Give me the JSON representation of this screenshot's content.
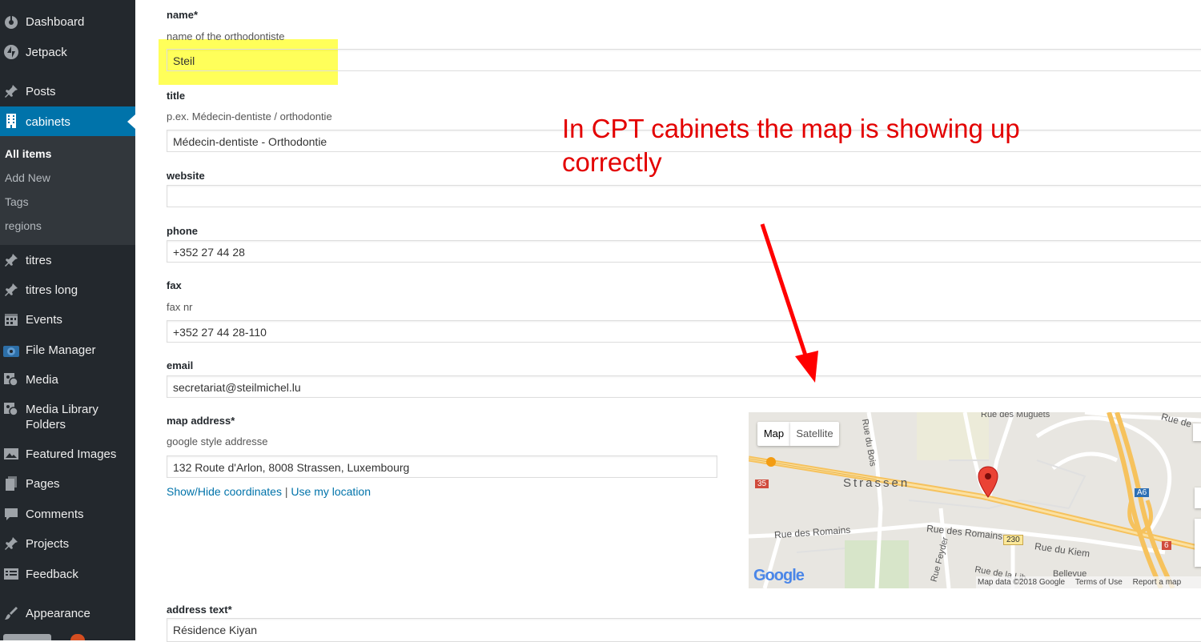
{
  "sidebar": {
    "items": [
      {
        "label": "Dashboard",
        "icon": "dashboard-icon"
      },
      {
        "label": "Jetpack",
        "icon": "jetpack-icon"
      },
      {
        "label": "Posts",
        "icon": "pin-icon"
      },
      {
        "label": "cabinets",
        "icon": "building-icon",
        "active": true
      },
      {
        "label": "titres",
        "icon": "pin-icon"
      },
      {
        "label": "titres long",
        "icon": "pin-icon"
      },
      {
        "label": "Events",
        "icon": "calendar-icon"
      },
      {
        "label": "File Manager",
        "icon": "file-manager-icon"
      },
      {
        "label": "Media",
        "icon": "media-icon"
      },
      {
        "label": "Media Library Folders",
        "icon": "media-icon"
      },
      {
        "label": "Featured Images",
        "icon": "image-icon"
      },
      {
        "label": "Pages",
        "icon": "pages-icon"
      },
      {
        "label": "Comments",
        "icon": "comment-icon"
      },
      {
        "label": "Projects",
        "icon": "pin-icon"
      },
      {
        "label": "Feedback",
        "icon": "feedback-icon"
      },
      {
        "label": "Appearance",
        "icon": "brush-icon"
      }
    ],
    "submenu": [
      "All items",
      "Add New",
      "Tags",
      "regions"
    ]
  },
  "form": {
    "name": {
      "label": "name*",
      "desc": "name of the orthodontiste",
      "value": "Steil"
    },
    "title": {
      "label": "title",
      "desc": "p.ex. Médecin-dentiste / orthodontie",
      "value": "Médecin-dentiste - Orthodontie"
    },
    "website": {
      "label": "website",
      "value": ""
    },
    "phone": {
      "label": "phone",
      "value": "+352 27 44 28"
    },
    "fax": {
      "label": "fax",
      "desc": "fax nr",
      "value": "+352 27 44 28-110"
    },
    "email": {
      "label": "email",
      "value": "secretariat@steilmichel.lu"
    },
    "map_address": {
      "label": "map address*",
      "desc": "google style addresse",
      "value": "132 Route d'Arlon, 8008 Strassen, Luxembourg",
      "show_hide": "Show/Hide coordinates",
      "separator": "|",
      "use_location": "Use my location"
    },
    "address_text": {
      "label": "address text*",
      "value": "Résidence Kiyan"
    }
  },
  "map": {
    "tab_map": "Map",
    "tab_satellite": "Satellite",
    "place": "Strassen",
    "streets": [
      "Rue des Romains",
      "Rue des Romains",
      "Rue du Kiem",
      "Rue du Bois",
      "Rue des Muguets",
      "Rue Feyder",
      "Rue de la Lib",
      "Bellevue",
      "Rue de"
    ],
    "road_badges": [
      "35",
      "230",
      "A6",
      "6"
    ],
    "logo": "Google",
    "attribution": "Map data ©2018 Google",
    "terms": "Terms of Use",
    "report": "Report a map"
  },
  "annotation": "In CPT cabinets the map is showing up correctly",
  "colors": {
    "sidebar": "#23282d",
    "active": "#0073aa",
    "highlight": "#ffff5a",
    "annotation": "#e30000"
  }
}
